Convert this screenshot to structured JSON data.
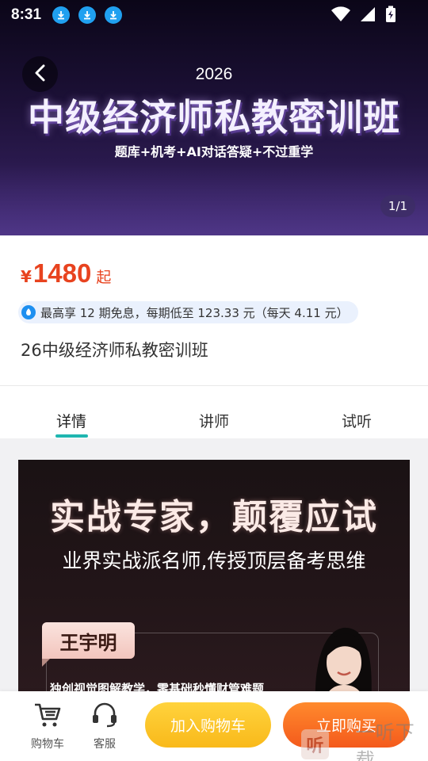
{
  "status_bar": {
    "time": "8:31"
  },
  "banner": {
    "year": "2026",
    "title": "中级经济师私教密训班",
    "subtitle": "题库+机考+AI对话答疑+不过重学",
    "counter": "1/1"
  },
  "product": {
    "price_symbol": "¥",
    "price": "1480",
    "price_suffix": "起",
    "installment": "最高享 12 期免息，每期低至 123.33 元（每天 4.11 元）",
    "name": "26中级经济师私教密训班"
  },
  "tabs": [
    {
      "label": "详情",
      "active": true
    },
    {
      "label": "讲师",
      "active": false
    },
    {
      "label": "试听",
      "active": false
    }
  ],
  "poster": {
    "headline": "实战专家，颠覆应试",
    "subline": "业界实战派名师,传授顶层备考思维",
    "teacher_name": "王宇明",
    "teacher_desc": "独创视觉图解教学，零基础秒懂财管难题"
  },
  "bottom_bar": {
    "cart_label": "购物车",
    "service_label": "客服",
    "add_to_cart": "加入购物车",
    "buy_now": "立即购买"
  },
  "watermark": {
    "logo_char": "听",
    "text": "一听下载"
  },
  "colors": {
    "price": "#e8431f",
    "tab_active": "#1fb6b0",
    "cart_button": "#f9b91a",
    "buy_button": "#f45a1c"
  }
}
